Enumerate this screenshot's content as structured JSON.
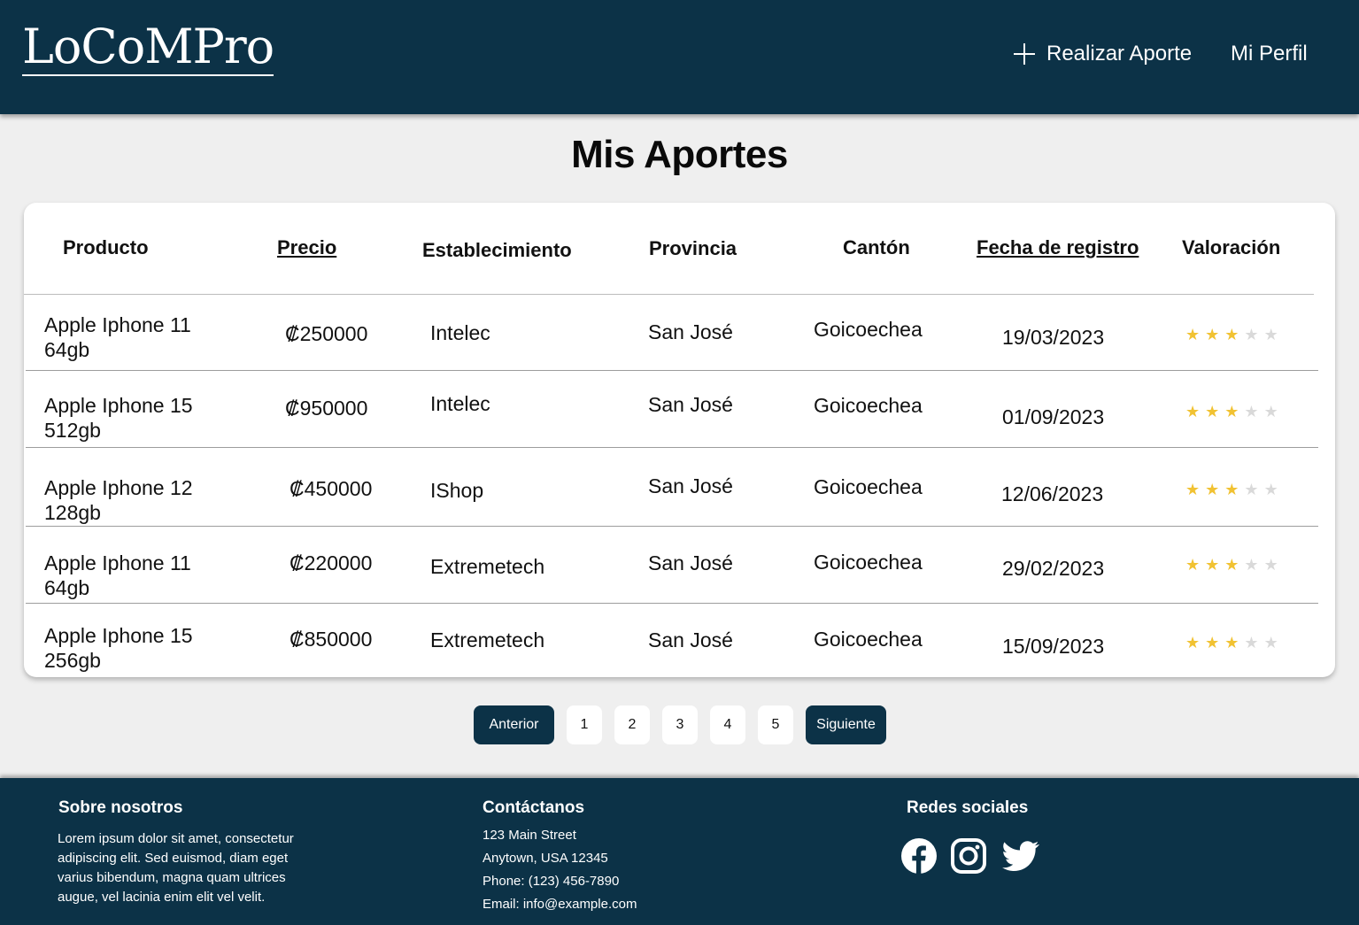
{
  "header": {
    "logo": "LoCoMPro",
    "contribute_label": "Realizar Aporte",
    "profile_label": "Mi Perfil"
  },
  "page_title": "Mis Aportes",
  "table": {
    "columns": [
      "Producto",
      "Precio",
      "Establecimiento",
      "Provincia",
      "Cantón",
      "Fecha de registro",
      "Valoración"
    ],
    "rows": [
      {
        "product": "Apple Iphone 11 64gb",
        "price": "₡250000",
        "store": "Intelec",
        "province": "San José",
        "canton": "Goicoechea",
        "date": "19/03/2023",
        "rating": 3
      },
      {
        "product": "Apple Iphone 15 512gb",
        "price": "₡950000",
        "store": "Intelec",
        "province": "San José",
        "canton": "Goicoechea",
        "date": "01/09/2023",
        "rating": 3
      },
      {
        "product": "Apple Iphone 12 128gb",
        "price": "₡450000",
        "store": "IShop",
        "province": "San José",
        "canton": "Goicoechea",
        "date": "12/06/2023",
        "rating": 3
      },
      {
        "product": "Apple Iphone 11 64gb",
        "price": "₡220000",
        "store": "Extremetech",
        "province": "San José",
        "canton": "Goicoechea",
        "date": "29/02/2023",
        "rating": 3
      },
      {
        "product": "Apple Iphone 15 256gb",
        "price": "₡850000",
        "store": "Extremetech",
        "province": "San José",
        "canton": "Goicoechea",
        "date": "15/09/2023",
        "rating": 3
      }
    ],
    "rating_max": 5,
    "star_color": "#f1c232"
  },
  "pagination": {
    "prev_label": "Anterior",
    "pages": [
      "1",
      "2",
      "3",
      "4",
      "5"
    ],
    "next_label": "Siguiente"
  },
  "footer": {
    "about": {
      "title": "Sobre nosotros",
      "lines": [
        "Lorem ipsum dolor sit amet, consectetur",
        "adipiscing elit. Sed euismod, diam eget",
        "varius bibendum, magna quam ultrices",
        "augue, vel lacinia enim elit vel velit."
      ]
    },
    "contact": {
      "title": "Contáctanos",
      "lines": [
        "123 Main Street",
        "Anytown, USA 12345",
        "Phone: (123) 456-7890",
        "Email: info@example.com"
      ]
    },
    "social": {
      "title": "Redes sociales",
      "icons": [
        "facebook-icon",
        "instagram-icon",
        "twitter-icon"
      ]
    }
  },
  "colors": {
    "brand_dark": "#0c3247",
    "background": "#efefef"
  }
}
